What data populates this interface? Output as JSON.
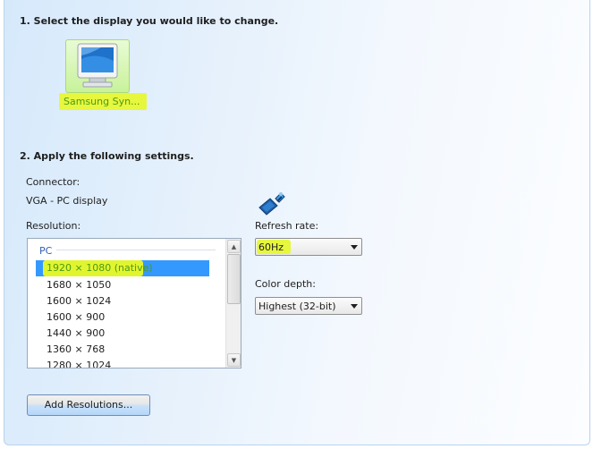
{
  "step1": {
    "title": "1. Select the display you would like to change."
  },
  "display": {
    "name": "Samsung Syn..."
  },
  "step2": {
    "title": "2. Apply the following settings."
  },
  "connector": {
    "label": "Connector:",
    "value": "VGA - PC display"
  },
  "resolution": {
    "label": "Resolution:",
    "group": "PC",
    "items": [
      "1920 × 1080 (native)",
      "1680 × 1050",
      "1600 × 1024",
      "1600 × 900",
      "1440 × 900",
      "1360 × 768",
      "1280 × 1024"
    ],
    "selected_index": 0
  },
  "refresh_rate": {
    "label": "Refresh rate:",
    "value": "60Hz"
  },
  "color_depth": {
    "label": "Color depth:",
    "value": "Highest (32-bit)"
  },
  "buttons": {
    "add_resolutions": "Add Resolutions..."
  },
  "colors": {
    "highlight": "#e6f73e",
    "highlight_text": "#4c9a17",
    "selection": "#3399ff",
    "group_label": "#3260b3"
  },
  "icons": [
    "monitor-icon",
    "vga-connector-icon",
    "scroll-up-icon",
    "scroll-down-icon",
    "dropdown-arrow-icon"
  ]
}
